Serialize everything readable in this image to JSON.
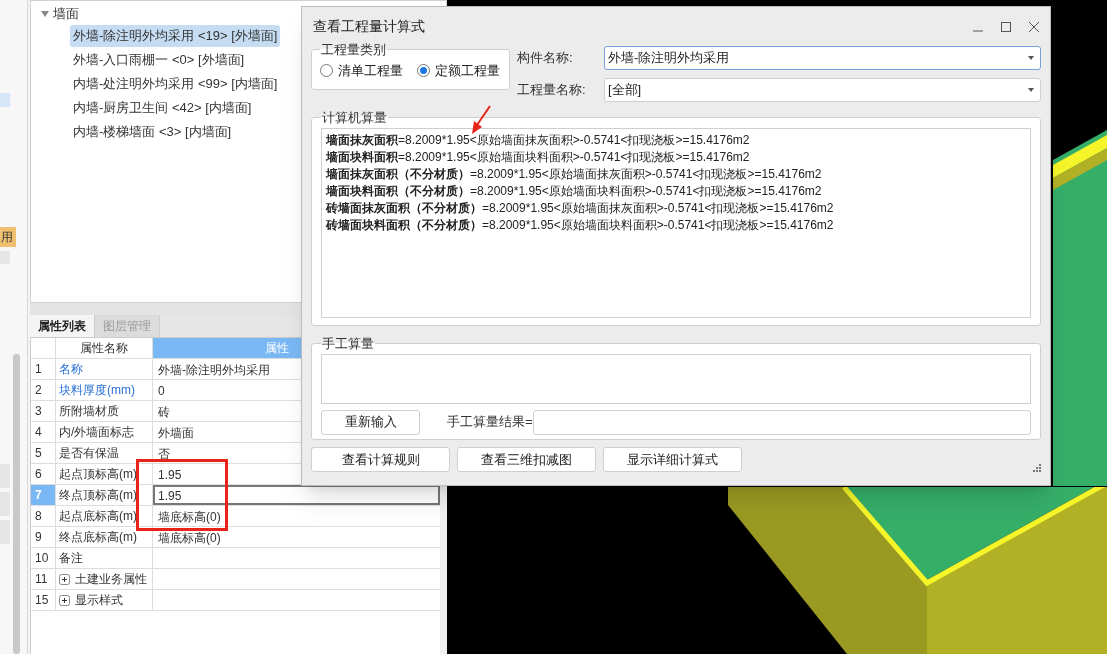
{
  "sidebar": {
    "fragment": "用"
  },
  "tree": {
    "label": "墙面",
    "expanded": true,
    "children": [
      {
        "label": "外墙-除注明外均采用 <19> [外墙面]",
        "selected": true
      },
      {
        "label": "外墙-入口雨棚一 <0> [外墙面]",
        "selected": false
      },
      {
        "label": "内墙-处注明外均采用 <99> [内墙面]",
        "selected": false
      },
      {
        "label": "内墙-厨房卫生间 <42> [内墙面]",
        "selected": false
      },
      {
        "label": "内墙-楼梯墙面 <3> [内墙面]",
        "selected": false
      }
    ]
  },
  "property_panel": {
    "tabs": [
      {
        "label": "属性列表",
        "selected": true
      },
      {
        "label": "图层管理",
        "selected": false
      }
    ],
    "columns": [
      "属性名称",
      "属性"
    ],
    "rows": [
      {
        "num": "1",
        "name": "名称",
        "value": "外墙-除注明外均采用",
        "kind": "link",
        "selected": false
      },
      {
        "num": "2",
        "name": "块料厚度(mm)",
        "value": "0",
        "kind": "link",
        "selected": false
      },
      {
        "num": "3",
        "name": "所附墙材质",
        "value": "砖",
        "kind": "plain",
        "selected": false
      },
      {
        "num": "4",
        "name": "内/外墙面标志",
        "value": "外墙面",
        "kind": "plain",
        "selected": false
      },
      {
        "num": "5",
        "name": "是否有保温",
        "value": "否",
        "kind": "plain",
        "selected": false
      },
      {
        "num": "6",
        "name": "起点顶标高(m)",
        "value": "1.95",
        "kind": "plain",
        "selected": false
      },
      {
        "num": "7",
        "name": "终点顶标高(m)",
        "value": "1.95",
        "kind": "plain",
        "selected": true
      },
      {
        "num": "8",
        "name": "起点底标高(m)",
        "value": "墙底标高(0)",
        "kind": "plain",
        "selected": false
      },
      {
        "num": "9",
        "name": "终点底标高(m)",
        "value": "墙底标高(0)",
        "kind": "plain",
        "selected": false
      },
      {
        "num": "10",
        "name": "备注",
        "kind": "plain",
        "selected": false
      },
      {
        "num": "11",
        "name": "土建业务属性",
        "kind": "group",
        "expanded": false,
        "selected": false
      },
      {
        "num": "15",
        "name": "显示样式",
        "kind": "group",
        "expanded": false,
        "selected": false
      }
    ]
  },
  "dialog": {
    "title": "查看工程量计算式",
    "category": {
      "legend": "工程量类别",
      "options": [
        {
          "label": "清单工程量",
          "selected": false
        },
        {
          "label": "定额工程量",
          "selected": true
        }
      ]
    },
    "fields": [
      {
        "label": "构件名称:",
        "value": "外墙-除注明外均采用",
        "focused": true
      },
      {
        "label": "工程量名称:",
        "value": "[全部]",
        "focused": false
      }
    ],
    "computer": {
      "legend": "计算机算量",
      "lines": [
        "**墙面抹灰面积**=8.2009*1.95<原始墙面抹灰面积>-0.5741<扣现浇板>=15.4176m2",
        "**墙面块料面积**=8.2009*1.95<原始墙面块料面积>-0.5741<扣现浇板>=15.4176m2",
        "**墙面抹灰面积（不分材质）**=8.2009*1.95<原始墙面抹灰面积>-0.5741<扣现浇板>=15.4176m2",
        "**墙面块料面积（不分材质）**=8.2009*1.95<原始墙面块料面积>-0.5741<扣现浇板>=15.4176m2",
        "**砖墙面抹灰面积（不分材质）**=8.2009*1.95<原始墙面抹灰面积>-0.5741<扣现浇板>=15.4176m2",
        "**砖墙面块料面积（不分材质）**=8.2009*1.95<原始墙面块料面积>-0.5741<扣现浇板>=15.4176m2"
      ]
    },
    "manual": {
      "legend": "手工算量",
      "reset_button": "重新输入",
      "result_label": "手工算量结果="
    },
    "buttons": [
      "查看计算规则",
      "查看三维扣减图",
      "显示详细计算式"
    ]
  }
}
